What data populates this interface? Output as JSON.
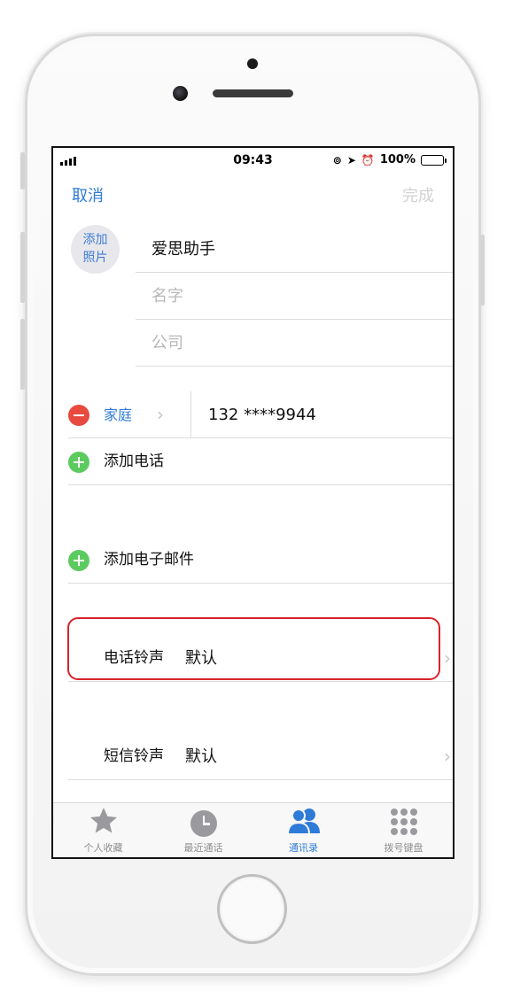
{
  "status": {
    "time": "09:43",
    "battery": "100%",
    "battery_level": 1.0
  },
  "nav": {
    "cancel": "取消",
    "done": "完成"
  },
  "contact": {
    "add_photo_line1": "添加",
    "add_photo_line2": "照片",
    "last_name": "爱思助手",
    "first_name_placeholder": "名字",
    "company_placeholder": "公司"
  },
  "phone": {
    "label": "家庭",
    "number": "132 ****9944"
  },
  "add_phone": "添加电话",
  "add_email": "添加电子邮件",
  "ringtone": {
    "label": "电话铃声",
    "value": "默认"
  },
  "text_tone": {
    "label": "短信铃声",
    "value": "默认"
  },
  "tabs": [
    {
      "label": "个人收藏",
      "icon": "star-icon"
    },
    {
      "label": "最近通话",
      "icon": "clock-icon"
    },
    {
      "label": "通讯录",
      "icon": "contacts-icon",
      "active": true
    },
    {
      "label": "拨号键盘",
      "icon": "keypad-icon"
    }
  ],
  "colors": {
    "accent": "#2f7bd8",
    "delete": "#e84a3f",
    "add": "#5ccb5f",
    "highlight": "#d8232a"
  }
}
